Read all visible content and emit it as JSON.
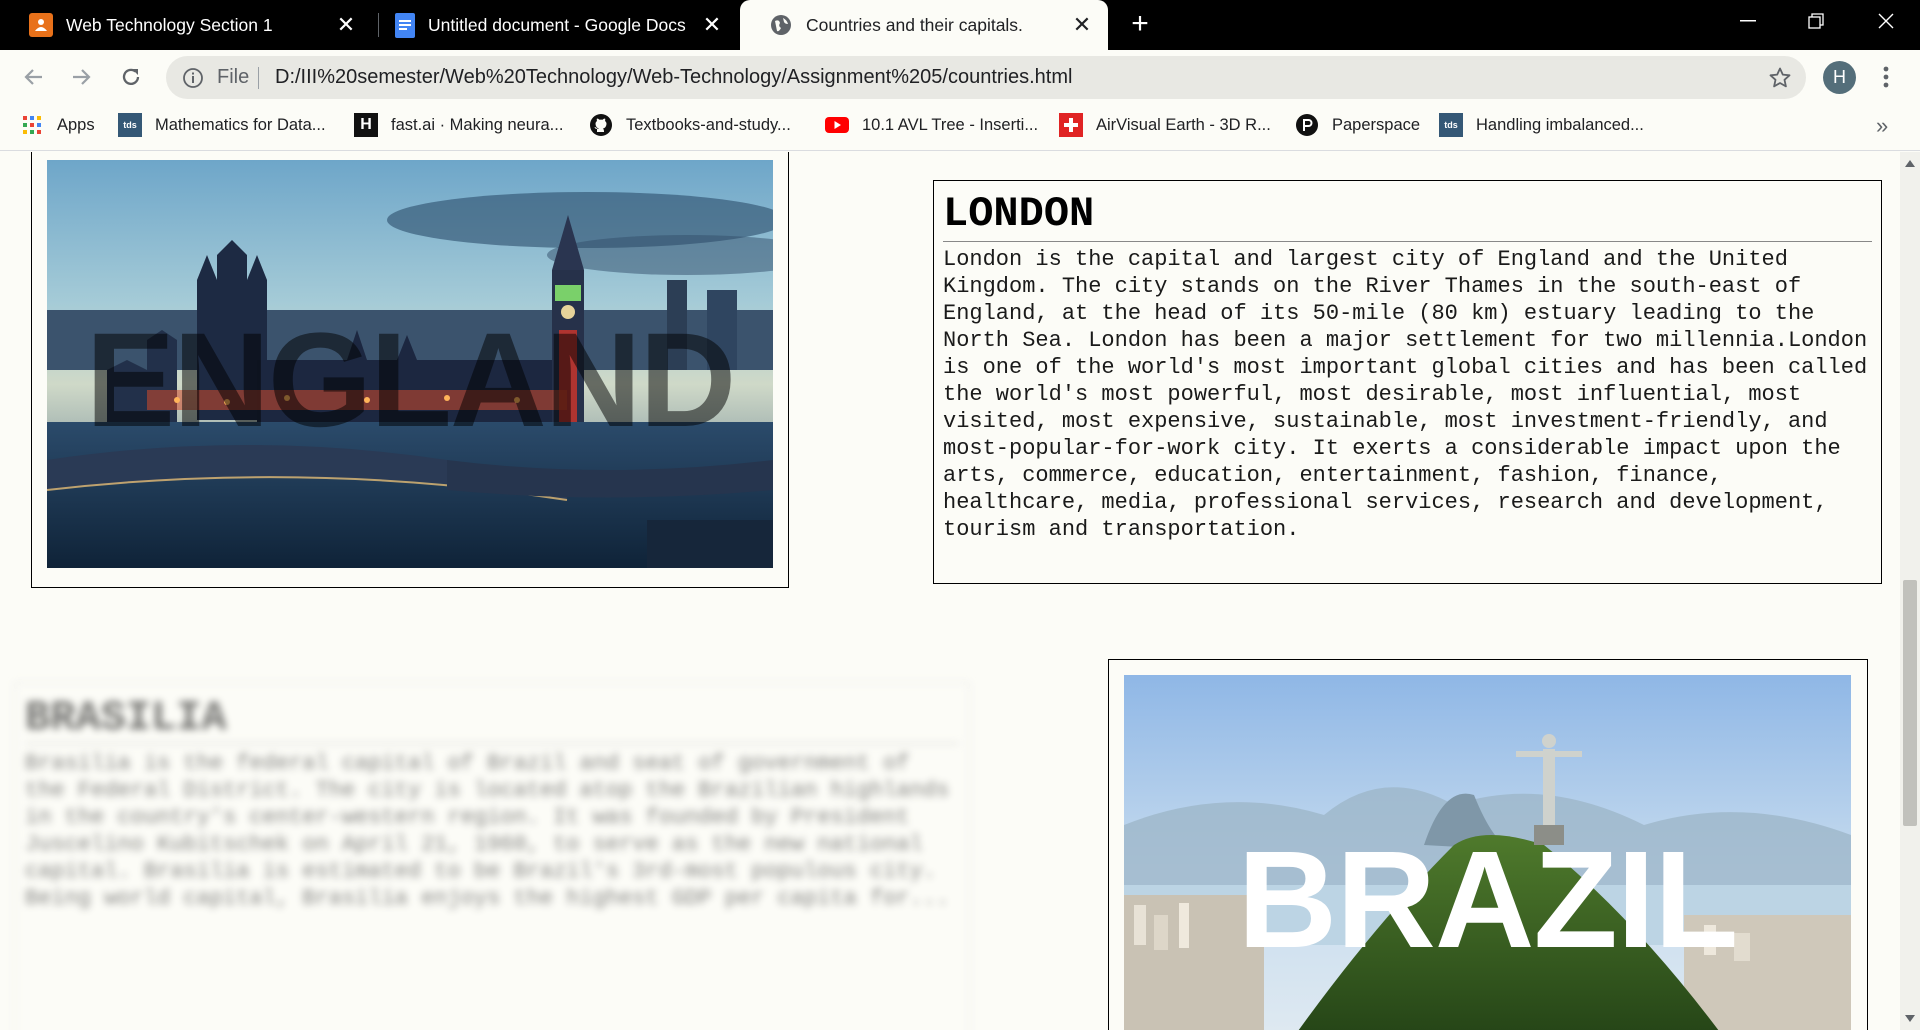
{
  "tabs": [
    {
      "title": "Web Technology Section 1",
      "icon": "person-presentation-icon",
      "active": false
    },
    {
      "title": "Untitled document - Google Docs",
      "icon": "docs-icon",
      "active": false
    },
    {
      "title": "Countries and their capitals.",
      "icon": "globe-icon",
      "active": true
    }
  ],
  "toolbar": {
    "scheme_label": "File",
    "url": "D:/III%20semester/Web%20Technology/Web-Technology/Assignment%205/countries.html",
    "avatar_letter": "H"
  },
  "bookmarks": [
    {
      "label": "Apps",
      "icon": "apps-grid-icon"
    },
    {
      "label": "Mathematics for Data...",
      "icon": "tds-icon"
    },
    {
      "label": "fast.ai · Making neura...",
      "icon": "fastai-icon"
    },
    {
      "label": "Textbooks-and-study...",
      "icon": "github-icon"
    },
    {
      "label": "10.1 AVL Tree - Inserti...",
      "icon": "youtube-icon"
    },
    {
      "label": "AirVisual Earth - 3D R...",
      "icon": "airvisual-icon"
    },
    {
      "label": "Paperspace",
      "icon": "paperspace-icon"
    },
    {
      "label": "Handling imbalanced...",
      "icon": "tds-icon"
    }
  ],
  "page": {
    "england": {
      "image_word": "ENGLAND",
      "heading": "LONDON",
      "paragraph": "London is the capital and largest city of England and the United Kingdom. The city stands on the River Thames in the south-east of England, at the head of its 50-mile (80 km) estuary leading to the North Sea. London has been a major settlement for two millennia.London is one of the world's most important global cities and has been called the world's most powerful, most desirable, most influential, most visited, most expensive, sustainable, most investment-friendly, and most-popular-for-work city. It exerts a considerable impact upon the arts, commerce, education, entertainment, fashion, finance, healthcare, media, professional services, research and development, tourism and transportation."
    },
    "brazil": {
      "image_word": "BRAZIL",
      "heading": "BRASILIA",
      "paragraph": "Brasilia is the federal capital of Brazil and seat of government of the Federal District. The city is located atop the Brazilian highlands in the country's center-western region. It was founded by President Juscelino Kubitschek on April 21, 1960, to serve as the new national capital. Brasilia is estimated to be Brazil's 3rd-most populous city. Being world capital, Brasilia enjoys the highest GDP per capita for..."
    }
  },
  "colors": {
    "page_bg": "#fcfcf7",
    "tabstrip_bg": "#000000",
    "omnibox_bg": "#e8e8e3"
  }
}
